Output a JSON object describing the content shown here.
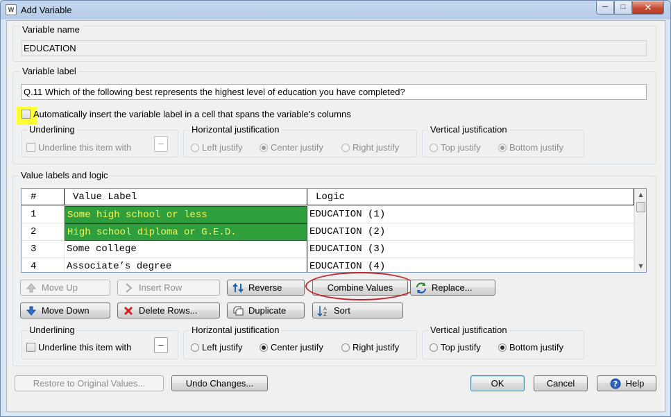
{
  "window": {
    "title": "Add Variable",
    "icon_text": "W"
  },
  "variable_name": {
    "label": "Variable name",
    "value": "EDUCATION"
  },
  "variable_label": {
    "label": "Variable label",
    "value": "Q.11 Which of the following best represents the highest level of education you have completed?",
    "auto_insert_label": "Automatically insert the variable label in a cell that spans the variable's columns"
  },
  "top_options": {
    "underlining": {
      "title": "Underlining",
      "checkbox_label": "Underline this item with",
      "char": "–"
    },
    "horizontal": {
      "title": "Horizontal justification",
      "left": "Left justify",
      "center": "Center justify",
      "right": "Right justify",
      "selected": "center"
    },
    "vertical": {
      "title": "Vertical justification",
      "top": "Top justify",
      "bottom": "Bottom justify",
      "selected": "bottom"
    }
  },
  "value_labels": {
    "title": "Value labels and logic",
    "columns": {
      "num": "#",
      "label": "Value Label",
      "logic": "Logic"
    },
    "rows": [
      {
        "num": "1",
        "label": "Some high school or less",
        "logic": "EDUCATION (1)",
        "selected": true
      },
      {
        "num": "2",
        "label": "High school diploma or G.E.D.",
        "logic": "EDUCATION (2)",
        "selected": true
      },
      {
        "num": "3",
        "label": "Some college",
        "logic": "EDUCATION (3)",
        "selected": false
      },
      {
        "num": "4",
        "label": "Associate’s degree",
        "logic": "EDUCATION (4)",
        "selected": false
      }
    ]
  },
  "buttons": {
    "move_up": "Move Up",
    "insert_row": "Insert Row",
    "reverse": "Reverse",
    "combine_values": "Combine Values",
    "replace": "Replace...",
    "move_down": "Move Down",
    "delete_rows": "Delete Rows...",
    "duplicate": "Duplicate",
    "sort": "Sort",
    "restore": "Restore to Original Values...",
    "undo": "Undo Changes...",
    "ok": "OK",
    "cancel": "Cancel",
    "help": "Help"
  },
  "bottom_options": {
    "underlining": {
      "title": "Underlining",
      "checkbox_label": "Underline this item with",
      "char": "–"
    },
    "horizontal": {
      "title": "Horizontal justification",
      "left": "Left justify",
      "center": "Center justify",
      "right": "Right justify",
      "selected": "center"
    },
    "vertical": {
      "title": "Vertical justification",
      "top": "Top justify",
      "bottom": "Bottom justify",
      "selected": "bottom"
    }
  },
  "colors": {
    "selection_fill": "#2f9f3e",
    "selection_text": "#f7f758",
    "highlight": "#ffff33",
    "annotation_circle": "#c0272d"
  }
}
